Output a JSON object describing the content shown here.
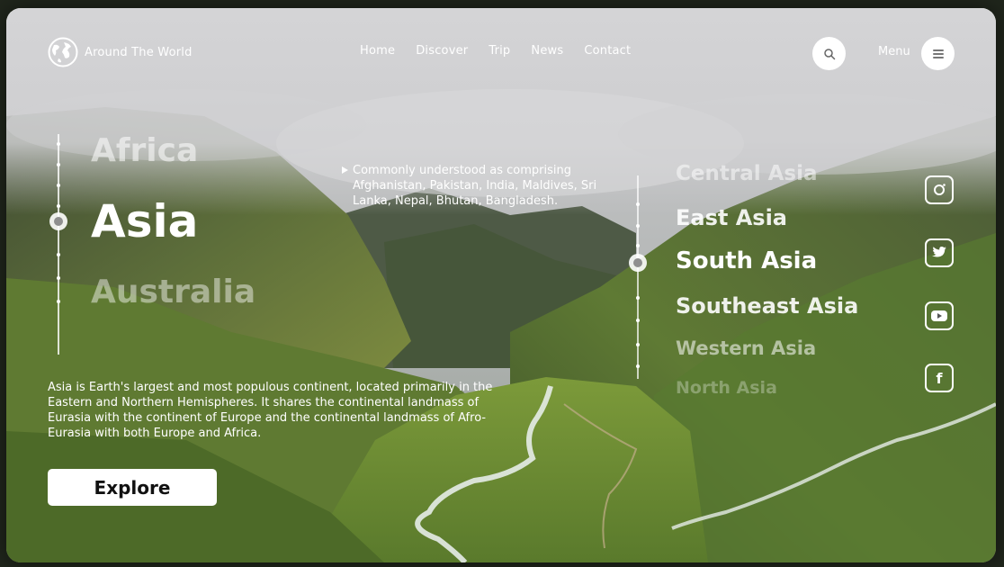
{
  "brand": {
    "name": "Around The World"
  },
  "nav": {
    "items": [
      "Home",
      "Discover",
      "Trip",
      "News",
      "Contact"
    ]
  },
  "header": {
    "menu_label": "Menu"
  },
  "continents": {
    "previous": "Africa",
    "active": "Asia",
    "next": "Australia"
  },
  "description": "Asia is Earth's largest and most populous continent, located primarily in the Eastern and Northern Hemispheres. It shares the continental landmass of Eurasia with the continent of Europe and the continental landmass of Afro-Eurasia with both Europe and Africa.",
  "explore_label": "Explore",
  "note": "Commonly understood as comprising Afghanistan, Pakistan, India, Maldives, Sri Lanka, Nepal, Bhutan, Bangladesh.",
  "regions": [
    "Central Asia",
    "East Asia",
    "South Asia",
    "Southeast Asia",
    "Western Asia",
    "North Asia"
  ],
  "active_region": "South Asia",
  "social": [
    "instagram-icon",
    "twitter-icon",
    "youtube-icon",
    "facebook-icon"
  ],
  "icons": {
    "logo": "globe-icon",
    "search": "search-icon",
    "menu": "hamburger-icon"
  }
}
